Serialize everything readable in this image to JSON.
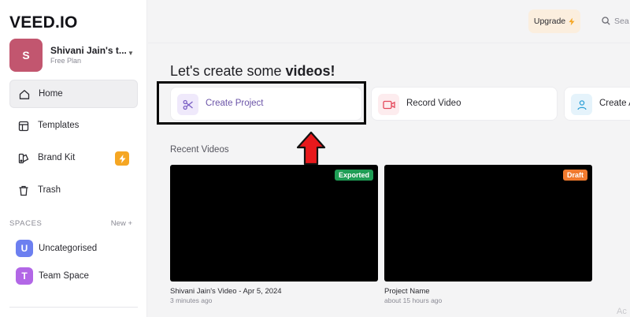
{
  "app": {
    "logo": "VEED.IO"
  },
  "workspace": {
    "initial": "S",
    "name": "Shivani Jain's t...",
    "plan": "Free Plan"
  },
  "nav": [
    {
      "label": "Home",
      "icon": "home-icon"
    },
    {
      "label": "Templates",
      "icon": "templates-icon"
    },
    {
      "label": "Brand Kit",
      "icon": "brand-kit-icon"
    },
    {
      "label": "Trash",
      "icon": "trash-icon"
    }
  ],
  "spaces": {
    "title": "SPACES",
    "new_label": "New +",
    "items": [
      {
        "initial": "U",
        "label": "Uncategorised",
        "color": "#6c7ff0"
      },
      {
        "initial": "T",
        "label": "Team Space",
        "color": "#b267e6"
      }
    ]
  },
  "topbar": {
    "upgrade_label": "Upgrade",
    "search_label": "Sea"
  },
  "main": {
    "heading_prefix": "Let's create some",
    "heading_bold": "videos!",
    "actions": [
      {
        "label": "Create Project",
        "icon": "scissors-icon"
      },
      {
        "label": "Record Video",
        "icon": "record-video-icon"
      },
      {
        "label": "Create A",
        "icon": "create-avatar-icon"
      }
    ],
    "recent_title": "Recent Videos",
    "videos": [
      {
        "title": "Shivani Jain's Video - Apr 5, 2024",
        "time": "3 minutes ago",
        "badge": "Exported",
        "badge_color": "#1f9d55"
      },
      {
        "title": "Project Name",
        "time": "about 15 hours ago",
        "badge": "Draft",
        "badge_color": "#f07a2e"
      }
    ],
    "watermark": "Ac"
  }
}
